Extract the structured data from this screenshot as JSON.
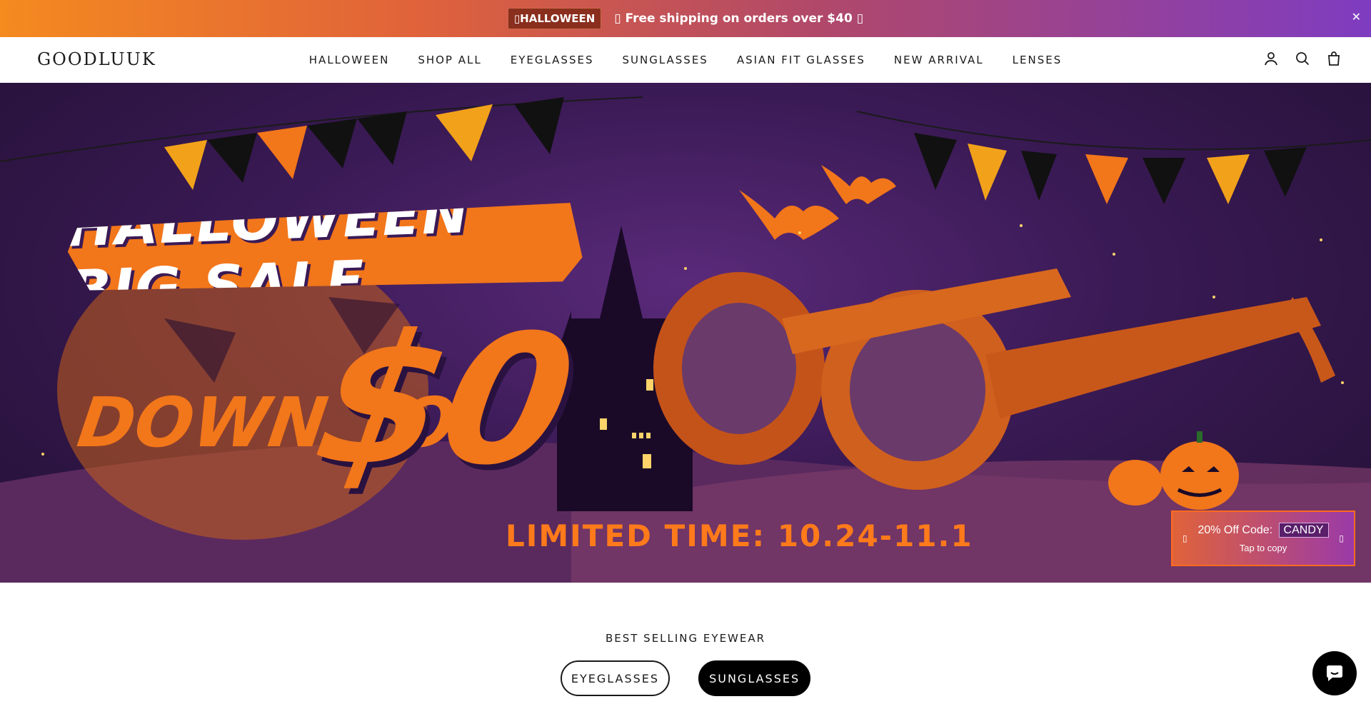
{
  "announcement": {
    "tag": "▯HALLOWEEN",
    "message": "▯ Free shipping on orders over $40 ▯",
    "close_icon": "close-icon"
  },
  "header": {
    "logo_text": "GOODLUUK",
    "nav": [
      {
        "label": "HALLOWEEN"
      },
      {
        "label": "SHOP ALL"
      },
      {
        "label": "EYEGLASSES"
      },
      {
        "label": "SUNGLASSES"
      },
      {
        "label": "ASIAN FIT GLASSES"
      },
      {
        "label": "NEW ARRIVAL"
      },
      {
        "label": "LENSES"
      }
    ],
    "icons": [
      "account-icon",
      "search-icon",
      "cart-icon"
    ]
  },
  "hero": {
    "title": "HALLOWEEN BIG SALE",
    "down_to": "DOWN TO",
    "price": "$0",
    "limited": "LIMITED TIME: 10.24-11.1"
  },
  "discount_widget": {
    "label": "20% Off Code:",
    "code": "CANDY",
    "sub": "Tap to copy",
    "arrow_left": "▯",
    "arrow_right": "▯"
  },
  "best_selling": {
    "title": "BEST SELLING EYEWEAR",
    "tabs": [
      {
        "label": "EYEGLASSES",
        "active": false
      },
      {
        "label": "SUNGLASSES",
        "active": true
      }
    ]
  },
  "colors": {
    "accent_orange": "#f2761a",
    "hero_purple": "#3a1a55",
    "brand_black": "#000000"
  }
}
